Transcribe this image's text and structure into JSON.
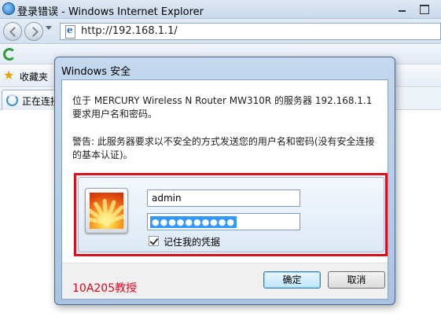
{
  "browser": {
    "title": "登录错误 - Windows Internet Explorer",
    "address": "http://192.168.1.1/",
    "favorites_label": "收藏夹",
    "tab_label": "正在连接"
  },
  "dialog": {
    "title": "Windows 安全",
    "message": "位于 MERCURY Wireless N Router MW310R 的服务器 192.168.1.1 要求用户名和密码。",
    "warning": "警告: 此服务器要求以不安全的方式发送您的用户名和密码(没有安全连接的基本认证)。",
    "username_value": "admin",
    "password_mask": "●●●●●●●●●●",
    "remember_label": "记住我的凭据",
    "remember_checked": true,
    "ok_label": "确定",
    "cancel_label": "取消",
    "watermark": "10A205教授"
  },
  "colors": {
    "highlight": "#d8111c",
    "watermark": "#e6001e",
    "selection": "#3399ff"
  }
}
